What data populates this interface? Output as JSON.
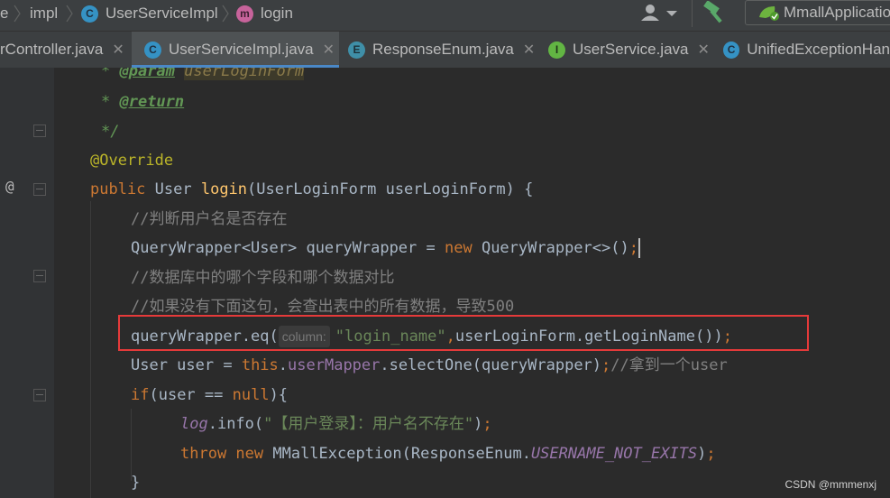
{
  "breadcrumb": {
    "items": [
      "e",
      "impl",
      "UserServiceImpl",
      "login"
    ]
  },
  "toolbar": {
    "run_config": "MmallApplicatio"
  },
  "tabs": [
    {
      "label": "rController.java"
    },
    {
      "label": "UserServiceImpl.java"
    },
    {
      "label": "ResponseEnum.java"
    },
    {
      "label": "UserService.java"
    },
    {
      "label": "UnifiedExceptionHan"
    }
  ],
  "tab_icons": [
    "C",
    "C",
    "E",
    "I",
    "C"
  ],
  "breadcrumb_icons": [
    "C",
    "m"
  ],
  "editor": {
    "gutter_marker": "@",
    "inlay_hint": "column:",
    "code": {
      "l1_star": "* ",
      "l1_tag": "@param",
      "l1_name": "userLoginForm",
      "l2_star": "* ",
      "l2_tag": "@return",
      "l3": "*/",
      "l4": "@Override",
      "l5_kw": "public ",
      "l5_type": "User ",
      "l5_fn": "login",
      "l5_rest_a": "(",
      "l5_param_type": "UserLoginForm",
      "l5_rest_b": " userLoginForm) {",
      "l6": "//判断用户名是否存在",
      "l7_a": "QueryWrapper<User> queryWrapper = ",
      "l7_kw": "new",
      "l7_b": " QueryWrapper<>()",
      "l7_semi": ";",
      "l8": "//数据库中的哪个字段和哪个数据对比",
      "l9": "//如果没有下面这句，会查出表中的所有数据，导致500",
      "l10_a": "queryWrapper.eq(",
      "l10_str": "\"login_name\"",
      "l10_comma": ",",
      "l10_b": "userLoginForm.getLoginName())",
      "l10_semi": ";",
      "l11_a": "User user = ",
      "l11_kw": "this",
      "l11_dot": ".",
      "l11_field": "userMapper",
      "l11_b": ".selectOne(queryWrapper)",
      "l11_semi": ";",
      "l11_cmt": "//拿到一个user",
      "l12_kw": "if",
      "l12_a": "(user == ",
      "l12_kw2": "null",
      "l12_b": "){",
      "l13_field": "log",
      "l13_a": ".info(",
      "l13_str": "\"【用户登录】：用户名不存在\"",
      "l13_b": ")",
      "l13_semi": ";",
      "l14_kw": "throw new ",
      "l14_a": "MMallException(ResponseEnum.",
      "l14_stat": "USERNAME_NOT_EXITS",
      "l14_b": ")",
      "l14_semi": ";",
      "l15": "}"
    }
  },
  "watermark": "CSDN @mmmenxj",
  "colors": {
    "background": "#2b2b2b",
    "highlight_box": "#e53a3a",
    "keyword": "#cc7832",
    "string": "#6a8759",
    "comment": "#808080",
    "annotation": "#bbb529"
  }
}
